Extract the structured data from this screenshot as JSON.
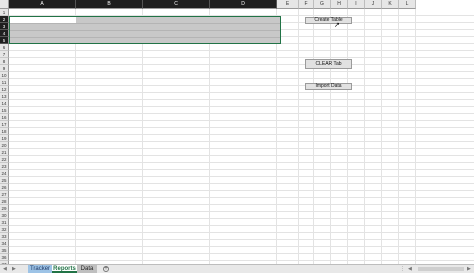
{
  "columns": [
    "A",
    "B",
    "C",
    "D",
    "E",
    "F",
    "G",
    "H",
    "I",
    "J",
    "K",
    "L"
  ],
  "selected_columns": [
    "A",
    "B",
    "C",
    "D"
  ],
  "rows": [
    "1",
    "2",
    "3",
    "4",
    "5",
    "6",
    "7",
    "8",
    "9",
    "10",
    "11",
    "12",
    "13",
    "14",
    "15",
    "16",
    "17",
    "18",
    "19",
    "20",
    "21",
    "22",
    "23",
    "24",
    "25",
    "26",
    "27",
    "28",
    "29",
    "30",
    "31",
    "32",
    "33",
    "34",
    "35",
    "36",
    "37",
    "38",
    "39"
  ],
  "selected_rows": [
    "2",
    "3",
    "4",
    "5"
  ],
  "buttons": {
    "create_table": "Create Table",
    "clear_tab": "CLEAR Tab",
    "import_data": "Import Data"
  },
  "tabs": {
    "tracker": "Tracker",
    "reports": "Reports",
    "data": "Data",
    "active": "Reports"
  },
  "colors": {
    "selection_fill": "#c8c8c8",
    "selection_border": "#217346",
    "tracker_tab": "#9dc3e6",
    "active_tab_text": "#217346"
  }
}
